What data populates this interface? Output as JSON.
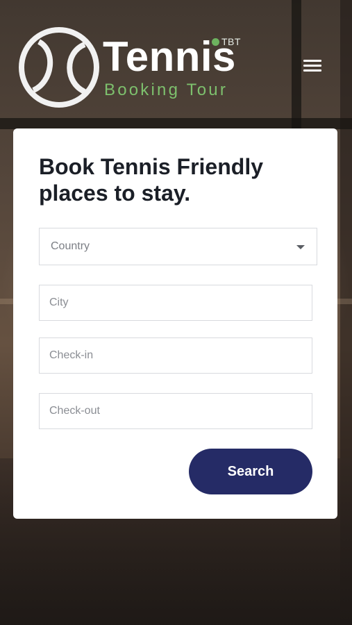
{
  "brand": {
    "badge": "TBT",
    "title": "Tennis",
    "subtitle": "Booking Tour",
    "accent_color": "#7dc06d"
  },
  "header": {
    "menu_icon": "hamburger-menu-icon"
  },
  "booking_form": {
    "heading": "Book Tennis Friendly places to stay.",
    "country": {
      "selected": "Country"
    },
    "city": {
      "placeholder": "City"
    },
    "check_in": {
      "placeholder": "Check-in"
    },
    "check_out": {
      "placeholder": "Check-out"
    },
    "search_label": "Search",
    "button_color": "#252b66"
  }
}
